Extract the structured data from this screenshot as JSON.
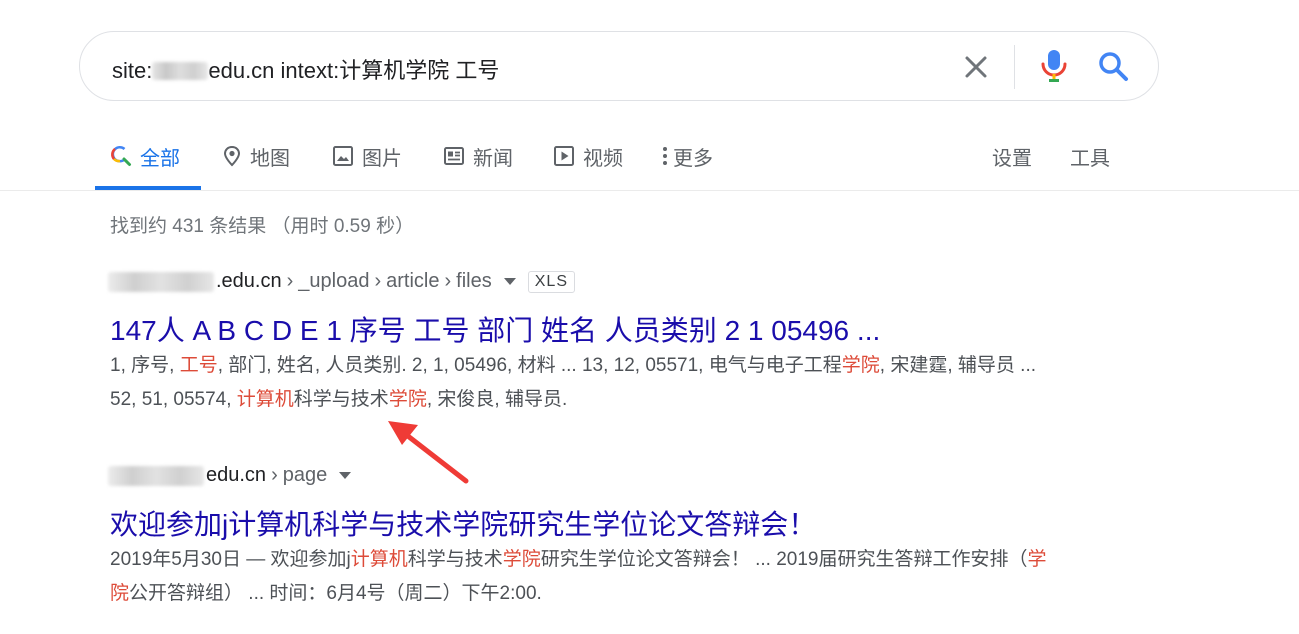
{
  "search": {
    "query_prefix": "site:",
    "query_suffix": "edu.cn intext:计算机学院 工号"
  },
  "tabs": [
    {
      "label": "全部",
      "icon": "search-icon",
      "active": true
    },
    {
      "label": "地图",
      "icon": "map-pin-icon"
    },
    {
      "label": "图片",
      "icon": "image-icon"
    },
    {
      "label": "新闻",
      "icon": "news-icon"
    },
    {
      "label": "视频",
      "icon": "video-icon"
    },
    {
      "label": "更多",
      "icon": "more-vert-icon"
    },
    {
      "label": "设置"
    },
    {
      "label": "工具"
    }
  ],
  "result_stats": "找到约 431 条结果 （用时 0.59 秒）",
  "results": [
    {
      "domain": ".edu.cn",
      "path": [
        "_upload",
        "article",
        "files"
      ],
      "badge": "XLS",
      "title": "147人 A B C D E 1 序号 工号 部门 姓名 人员类别 2 1 05496 ...",
      "snippet": [
        {
          "t": "1, 序号, "
        },
        {
          "t": "工号",
          "hl": true
        },
        {
          "t": ", 部门, 姓名, 人员类别. 2, 1, 05496, 材料 ... 13, 12, 05571, 电气与电子工程"
        },
        {
          "t": "学院",
          "hl": true
        },
        {
          "t": ", 宋建霆, 辅导员 ... 52, 51, 05574, "
        },
        {
          "t": "计算机",
          "hl": true
        },
        {
          "t": "科学与技术"
        },
        {
          "t": "学院",
          "hl": true
        },
        {
          "t": ", 宋俊良, 辅导员."
        }
      ]
    },
    {
      "domain": "edu.cn",
      "path": [
        "page"
      ],
      "title": "欢迎参加j计算机科学与技术学院研究生学位论文答辩会！",
      "snippet": [
        {
          "t": "2019年5月30日 — 欢迎参加j"
        },
        {
          "t": "计算机",
          "hl": true
        },
        {
          "t": "科学与技术"
        },
        {
          "t": "学院",
          "hl": true
        },
        {
          "t": "研究生学位论文答辩会！ ... 2019届研究生答辩工作安排（"
        },
        {
          "t": "学院",
          "hl": true
        },
        {
          "t": "公开答辩组） ... 时间：6月4号（周二）下午2:00."
        }
      ]
    }
  ],
  "colors": {
    "link": "#1a0dab",
    "accent": "#1a73e8",
    "highlight": "#dd4b39",
    "annotation_arrow": "#ef3b36"
  }
}
